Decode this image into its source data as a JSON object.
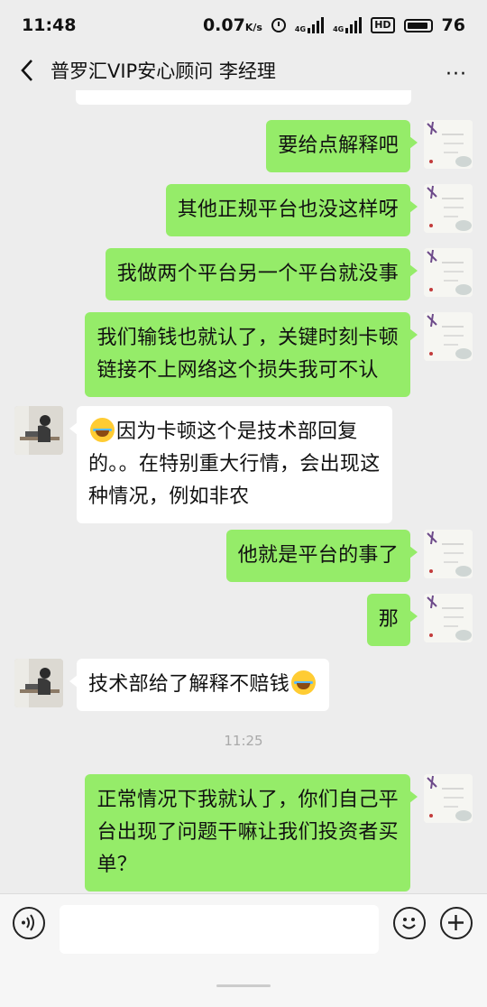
{
  "status": {
    "time": "11:48",
    "speed": "0.07",
    "speed_unit": "K/s",
    "net1": "4G",
    "net2": "4G",
    "hd": "HD",
    "battery": "76"
  },
  "header": {
    "title": "普罗汇VIP安心顾问 李经理",
    "more": "···"
  },
  "messages": [
    {
      "from": "me",
      "text": "要给点解释吧"
    },
    {
      "from": "me",
      "text": "其他正规平台也没这样呀"
    },
    {
      "from": "me",
      "text": "我做两个平台另一个平台就没事"
    },
    {
      "from": "me",
      "line1": "我们输钱也就认了，关键时刻卡顿",
      "line2": "链接不上网络这个损失我可不认"
    },
    {
      "from": "them",
      "line1": "因为卡顿这个是技术部回复",
      "line2": "的。。在特别重大行情，会出现这",
      "line3": "种情况，例如非农"
    },
    {
      "from": "me",
      "text": "他就是平台的事了"
    },
    {
      "from": "me",
      "text": "那"
    },
    {
      "from": "them",
      "text": "技术部给了解释不赔钱"
    },
    {
      "from": "me",
      "line1": "正常情况下我就认了，你们自己平",
      "line2": "台出现了问题干嘛让我们投资者买",
      "line3": "单？"
    }
  ],
  "timestamp": "11:25",
  "input": {
    "value": "",
    "placeholder": ""
  },
  "icons": [
    "back-icon",
    "more-icon",
    "voice-icon",
    "emoji-icon",
    "plus-icon",
    "laugh-cry-emoji"
  ],
  "colors": {
    "background": "#ededed",
    "my_bubble": "#95ec69",
    "their_bubble": "#ffffff",
    "timestamp": "#a9a9a9"
  }
}
